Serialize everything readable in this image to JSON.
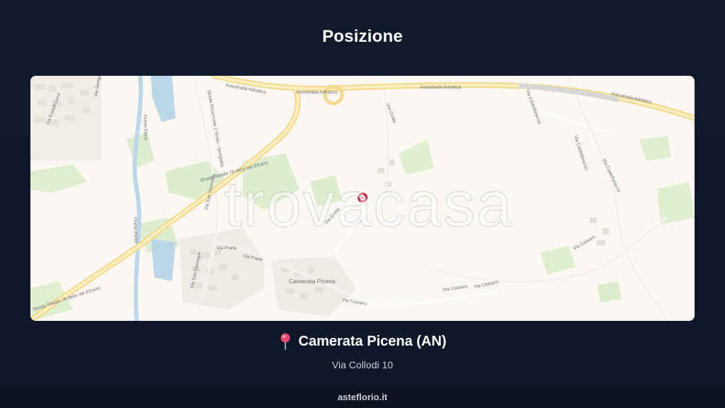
{
  "page": {
    "title": "Posizione"
  },
  "map": {
    "watermark": "trovacasa",
    "pin_icon": "map-marker-icon",
    "labels": {
      "autostrada_1": "Autostrada Adriatica",
      "autostrada_2": "Autostrada Adriatica",
      "autostrada_3": "Autostrada Adriatica",
      "autostrada_4": "Autostrada Adriatica",
      "statale_1": "Strada Statale 76 della Val d'Esino",
      "statale_2": "Strada Statale 76 della Val d'Esino",
      "provinciale": "Strada Provinciale 2 Sirolo - Senigallia",
      "camerata": "Camerata Picena",
      "via_prarie": "Via Prarie",
      "via_prarie_2": "Via Prarie",
      "via_san_giuseppe": "Via San Giuseppe",
      "via_san_giuseppe_2": "Via San Giuseppe",
      "via_cassero": "Via Cassero",
      "via_cassero_2": "Via Cassero",
      "via_cassero_3": "Via Cassero",
      "via_cassero_4": "Via Cassero",
      "via_castellaraccio": "Via Castellaraccio",
      "via_castellaraccio_2": "Via Castellaraccio",
      "via_castellaraccio_3": "Via Castellaraccio",
      "via_fratelli_cervi": "Via Fratelli Cervi",
      "via_grotte": "Via Grotte",
      "via_grotte_2": "Via Grotte",
      "fiume_esino": "Fiume Esino",
      "fiume_esino_2": "Fiume Esino",
      "via_senigallia": "Via Senigallia"
    }
  },
  "location": {
    "pin_icon": "round-pushpin-icon",
    "city": "Camerata Picena (AN)",
    "address": "Via Collodi 10"
  },
  "footer": {
    "site": "asteflorio.it"
  },
  "colors": {
    "background": "#111a2c",
    "map_base": "#fbf7f2",
    "motorway": "#f7e5a1",
    "green": "#d8ecc8",
    "water": "#bdd7ea",
    "pin": "#c8102e"
  }
}
